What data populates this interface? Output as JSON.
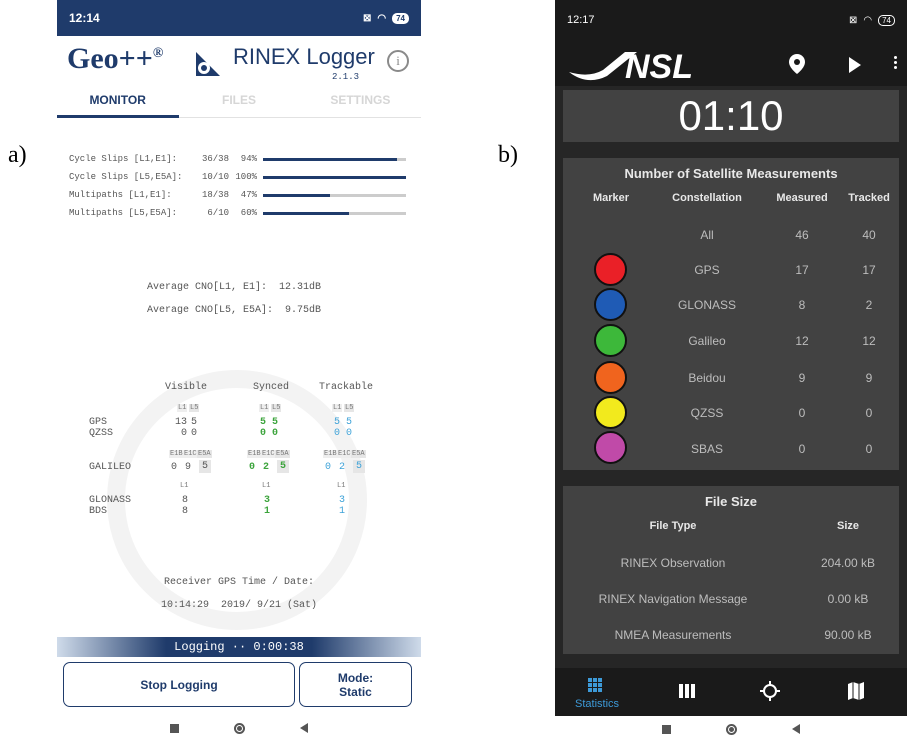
{
  "labels": {
    "a": "a)",
    "b": "b)"
  },
  "phoneA": {
    "time": "12:14",
    "battery": "74",
    "brand": "Geo++",
    "reg": "®",
    "app_title": "RINEX Logger",
    "version": "2.1.3",
    "info": "i",
    "tabs": [
      "MONITOR",
      "FILES",
      "SETTINGS"
    ],
    "cycle": [
      {
        "label": "Cycle Slips [L1,E1]:",
        "count": "36/38",
        "pct": "94%",
        "level": 0.94
      },
      {
        "label": "Cycle Slips [L5,E5A]:",
        "count": "10/10",
        "pct": "100%",
        "level": 1.0
      },
      {
        "label": "Multipaths [L1,E1]:",
        "count": "18/38",
        "pct": "47%",
        "level": 0.47
      },
      {
        "label": "Multipaths [L5,E5A]:",
        "count": "6/10",
        "pct": "60%",
        "level": 0.6
      }
    ],
    "avg1_label": "Average CNO[L1, E1]:",
    "avg1_val": "12.31dB",
    "avg2_label": "Average CNO[L5, E5A]:",
    "avg2_val": "9.75dB",
    "sat": {
      "col_visible": "Visible",
      "col_synced": "Synced",
      "col_trackable": "Trackable",
      "sub_l1": "L1",
      "sub_l5": "L5",
      "sub_e1b": "E1B",
      "sub_e1c": "E1C",
      "sub_e5a": "E5A",
      "gps": "GPS",
      "qzss": "QZSS",
      "galileo": "GALILEO",
      "glonass": "GLONASS",
      "bds": "BDS",
      "gps_vis": [
        "13",
        "5"
      ],
      "qzss_vis": [
        "0",
        "0"
      ],
      "gps_syn": [
        "5",
        "5"
      ],
      "qzss_syn": [
        "0",
        "0"
      ],
      "gps_trk": [
        "5",
        "5"
      ],
      "qzss_trk": [
        "0",
        "0"
      ],
      "gal_vis": [
        "0",
        "9",
        "5"
      ],
      "gal_syn": [
        "0",
        "2",
        "5"
      ],
      "gal_trk": [
        "0",
        "2",
        "5"
      ],
      "glo_vis": "8",
      "glo_syn": "3",
      "glo_trk": "3",
      "bds_vis": "8",
      "bds_syn": "1",
      "bds_trk": "1"
    },
    "recv_label": "Receiver GPS Time / Date:",
    "recv_time": "10:14:29",
    "recv_date": "2019/ 9/21 (Sat)",
    "logging_label": "Logging",
    "logging_sep": "··",
    "logging_time": "0:00:38",
    "stop_button": "Stop Logging",
    "mode_label": "Mode:",
    "mode_value": "Static"
  },
  "phoneB": {
    "time": "12:17",
    "battery": "74",
    "logo": "NSL",
    "timer": "01:10",
    "sat_title": "Number of Satellite Measurements",
    "cols": [
      "Marker",
      "Constellation",
      "Measured",
      "Tracked"
    ],
    "rows": [
      {
        "name": "All",
        "measured": "46",
        "tracked": "40",
        "color": ""
      },
      {
        "name": "GPS",
        "measured": "17",
        "tracked": "17",
        "color": "#ea2027"
      },
      {
        "name": "GLONASS",
        "measured": "8",
        "tracked": "2",
        "color": "#1f5bb5"
      },
      {
        "name": "Galileo",
        "measured": "12",
        "tracked": "12",
        "color": "#3db83a"
      },
      {
        "name": "Beidou",
        "measured": "9",
        "tracked": "9",
        "color": "#f0641e"
      },
      {
        "name": "QZSS",
        "measured": "0",
        "tracked": "0",
        "color": "#f2ea1d"
      },
      {
        "name": "SBAS",
        "measured": "0",
        "tracked": "0",
        "color": "#c04aa8"
      }
    ],
    "file_title": "File Size",
    "file_cols": [
      "File Type",
      "Size"
    ],
    "files": [
      {
        "type": "RINEX Observation",
        "size": "204.00 kB"
      },
      {
        "type": "RINEX Navigation Message",
        "size": "0.00 kB"
      },
      {
        "type": "NMEA Measurements",
        "size": "90.00 kB"
      }
    ],
    "nav_statistics": "Statistics",
    "accent": "#3d9ad8"
  }
}
